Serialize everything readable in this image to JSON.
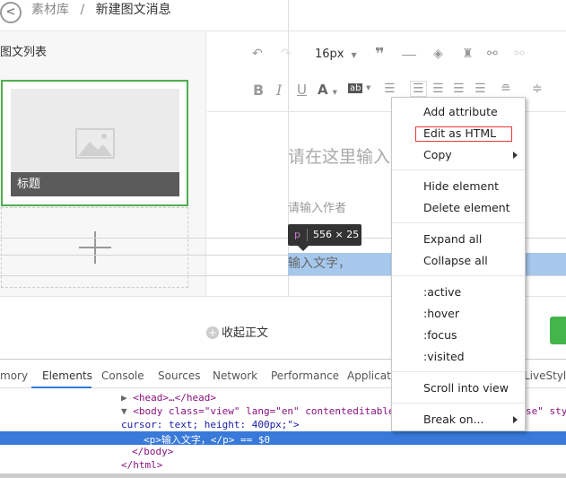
{
  "header": {
    "back_icon": "chevron-left-circle-icon",
    "crumb_parent": "素材库",
    "crumb_sep": "/",
    "crumb_current": "新建图文消息"
  },
  "left": {
    "title": "图文列表",
    "card_title": "标题",
    "image_icon": "image-placeholder-icon",
    "add_icon": "plus-icon"
  },
  "toolbar": {
    "font_size": "16px",
    "row1": [
      "undo-icon",
      "redo-icon",
      "font-size-select",
      "quote-icon",
      "horizontal-rule-icon",
      "eraser-icon",
      "format-brush-icon",
      "link-icon",
      "unlink-icon"
    ],
    "row2": [
      "bold-icon",
      "italic-icon",
      "underline-icon",
      "font-color-icon",
      "highlight-icon",
      "indent-icon",
      "align-left-icon",
      "align-center-icon",
      "align-right-icon",
      "align-justify-icon",
      "line-spacing-icon",
      "paragraph-spacing-icon"
    ],
    "bold": "B",
    "italic": "I",
    "underline": "U",
    "fontcolor": "A",
    "highlight": "ab"
  },
  "editor": {
    "title_placeholder": "请在这里输入",
    "author_placeholder": "请输入作者",
    "paragraph": "输入文字，",
    "tooltip_tag": "p",
    "tooltip_size": "556 × 25"
  },
  "footer": {
    "collapse_label": "收起正文",
    "accent": "#44b549"
  },
  "devtools": {
    "tabs": [
      "mory",
      "Elements",
      "Console",
      "Sources",
      "Network",
      "Performance",
      "Applicati",
      "LiveStyle"
    ],
    "active_tab": "Elements",
    "selection_color": "#3879d9",
    "code": {
      "head": "<head>…</head>",
      "body_open": "<body class=\"view\" lang=\"en\" contenteditable",
      "body_tail": "se\" sty",
      "body_cont": "cursor: text; height: 400px;\">",
      "selected": "<p>输入文字，</p> == $0",
      "body_close": "</body>",
      "html_close": "</html>"
    }
  },
  "context_menu": {
    "items": [
      "Add attribute",
      "Edit as HTML",
      "Copy",
      "Hide element",
      "Delete element",
      "Expand all",
      "Collapse all",
      ":active",
      ":hover",
      ":focus",
      ":visited",
      "Scroll into view",
      "Break on..."
    ],
    "highlighted": "Edit as HTML",
    "highlight_color": "#e53935"
  }
}
